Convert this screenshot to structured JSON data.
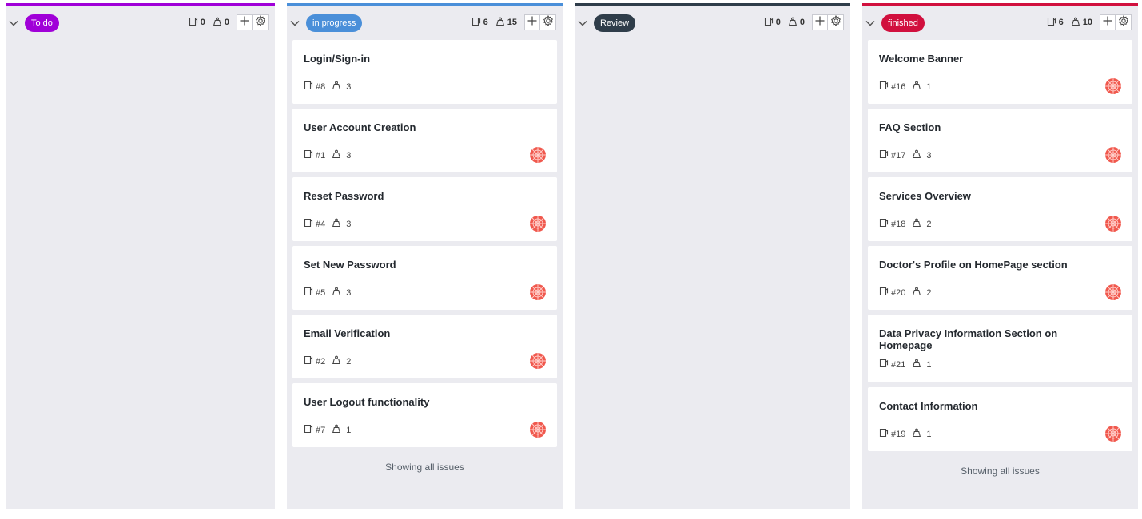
{
  "columns": [
    {
      "label": "To do",
      "color": "#a000d8",
      "issue_count": "0",
      "points": "0",
      "cards": [],
      "footer": ""
    },
    {
      "label": "in progress",
      "color": "#4a8fd9",
      "issue_count": "6",
      "points": "15",
      "cards": [
        {
          "title": "Login/Sign-in",
          "number": "#8",
          "points": "3",
          "avatar": false
        },
        {
          "title": "User Account Creation",
          "number": "#1",
          "points": "3",
          "avatar": true
        },
        {
          "title": "Reset Password",
          "number": "#4",
          "points": "3",
          "avatar": true
        },
        {
          "title": "Set New Password",
          "number": "#5",
          "points": "3",
          "avatar": true
        },
        {
          "title": "Email Verification",
          "number": "#2",
          "points": "2",
          "avatar": true
        },
        {
          "title": "User Logout functionality",
          "number": "#7",
          "points": "1",
          "avatar": true
        }
      ],
      "footer": "Showing all issues"
    },
    {
      "label": "Review",
      "color": "#2f3d4a",
      "issue_count": "0",
      "points": "0",
      "cards": [],
      "footer": ""
    },
    {
      "label": "finished",
      "color": "#d1103e",
      "issue_count": "6",
      "points": "10",
      "cards": [
        {
          "title": "Welcome Banner",
          "number": "#16",
          "points": "1",
          "avatar": true
        },
        {
          "title": "FAQ Section",
          "number": "#17",
          "points": "3",
          "avatar": true
        },
        {
          "title": "Services Overview",
          "number": "#18",
          "points": "2",
          "avatar": true
        },
        {
          "title": "Doctor's Profile on HomePage section",
          "number": "#20",
          "points": "2",
          "avatar": true
        },
        {
          "title": "Data Privacy Information Section on Homepage",
          "number": "#21",
          "points": "1",
          "avatar": false
        },
        {
          "title": "Contact Information",
          "number": "#19",
          "points": "1",
          "avatar": true
        }
      ],
      "footer": "Showing all issues"
    }
  ],
  "icons": {
    "collapse": "chevron-down-icon",
    "issue": "issue-icon",
    "points": "weight-icon",
    "add": "plus-icon",
    "settings": "gear-icon",
    "avatar": "avatar-icon"
  },
  "colors": {
    "board_bg": "#ebebf0",
    "avatar": "#f0584d"
  }
}
